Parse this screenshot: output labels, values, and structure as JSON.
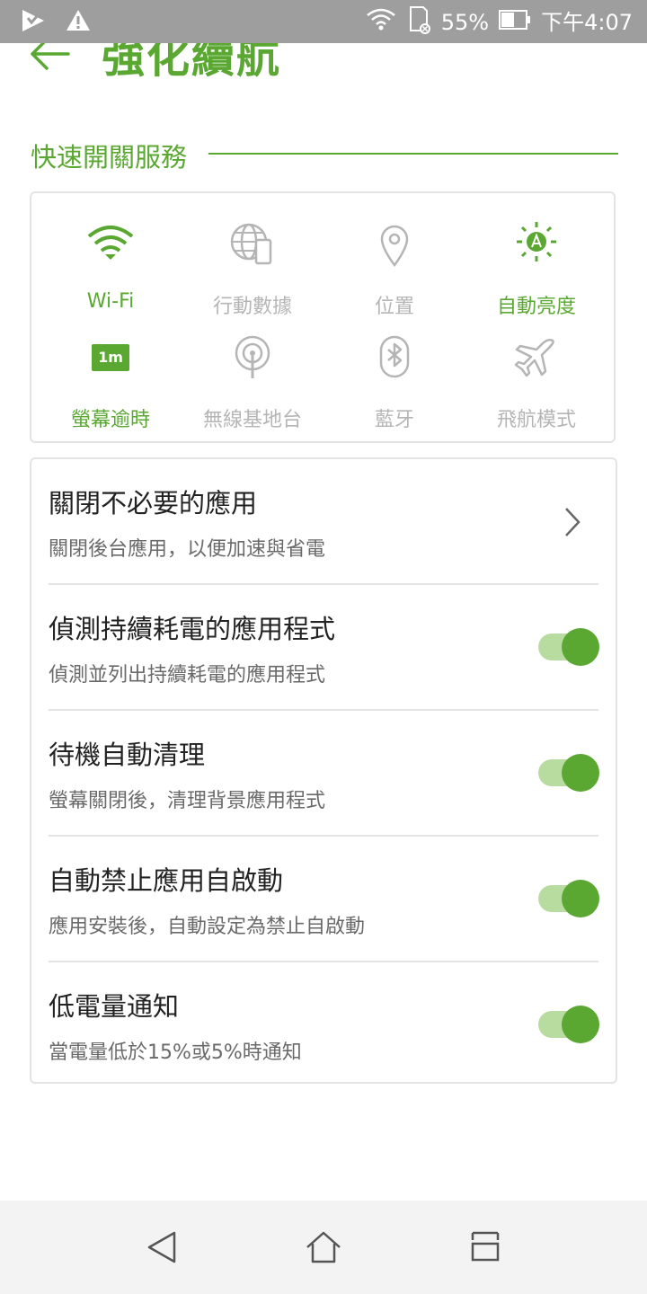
{
  "status_bar": {
    "battery_percent": "55%",
    "time": "下午4:07",
    "icons": [
      "play-icon",
      "warning-icon",
      "wifi-icon",
      "sd-card-icon",
      "battery-icon"
    ]
  },
  "header": {
    "title": "強化續航",
    "back_icon": "back-arrow-icon"
  },
  "quick_section": {
    "title": "快速開關服務",
    "items": [
      {
        "label": "Wi-Fi",
        "icon": "wifi-icon",
        "state": "on"
      },
      {
        "label": "行動數據",
        "icon": "mobile-data-icon",
        "state": "off"
      },
      {
        "label": "位置",
        "icon": "location-icon",
        "state": "off"
      },
      {
        "label": "自動亮度",
        "icon": "auto-brightness-icon",
        "state": "on"
      },
      {
        "label": "螢幕逾時",
        "icon": "screen-timeout-icon",
        "badge": "1m",
        "state": "on"
      },
      {
        "label": "無線基地台",
        "icon": "hotspot-icon",
        "state": "off"
      },
      {
        "label": "藍牙",
        "icon": "bluetooth-icon",
        "state": "off"
      },
      {
        "label": "飛航模式",
        "icon": "airplane-icon",
        "state": "off"
      }
    ]
  },
  "settings": [
    {
      "title": "關閉不必要的應用",
      "subtitle": "關閉後台應用，以便加速與省電",
      "control": "chevron"
    },
    {
      "title": "偵測持續耗電的應用程式",
      "subtitle": "偵測並列出持續耗電的應用程式",
      "control": "toggle",
      "enabled": true
    },
    {
      "title": "待機自動清理",
      "subtitle": "螢幕關閉後，清理背景應用程式",
      "control": "toggle",
      "enabled": true
    },
    {
      "title": "自動禁止應用自啟動",
      "subtitle": "應用安裝後，自動設定為禁止自啟動",
      "control": "toggle",
      "enabled": true
    },
    {
      "title": "低電量通知",
      "subtitle": "當電量低於15%或5%時通知",
      "control": "toggle",
      "enabled": true
    }
  ],
  "colors": {
    "accent": "#5aa832",
    "accent_light": "#b8dc9f",
    "inactive": "#b5b5b5",
    "status_bar": "#9e9e9e"
  },
  "nav_bar": {
    "icons": [
      "back-nav-icon",
      "home-nav-icon",
      "recents-nav-icon"
    ]
  }
}
